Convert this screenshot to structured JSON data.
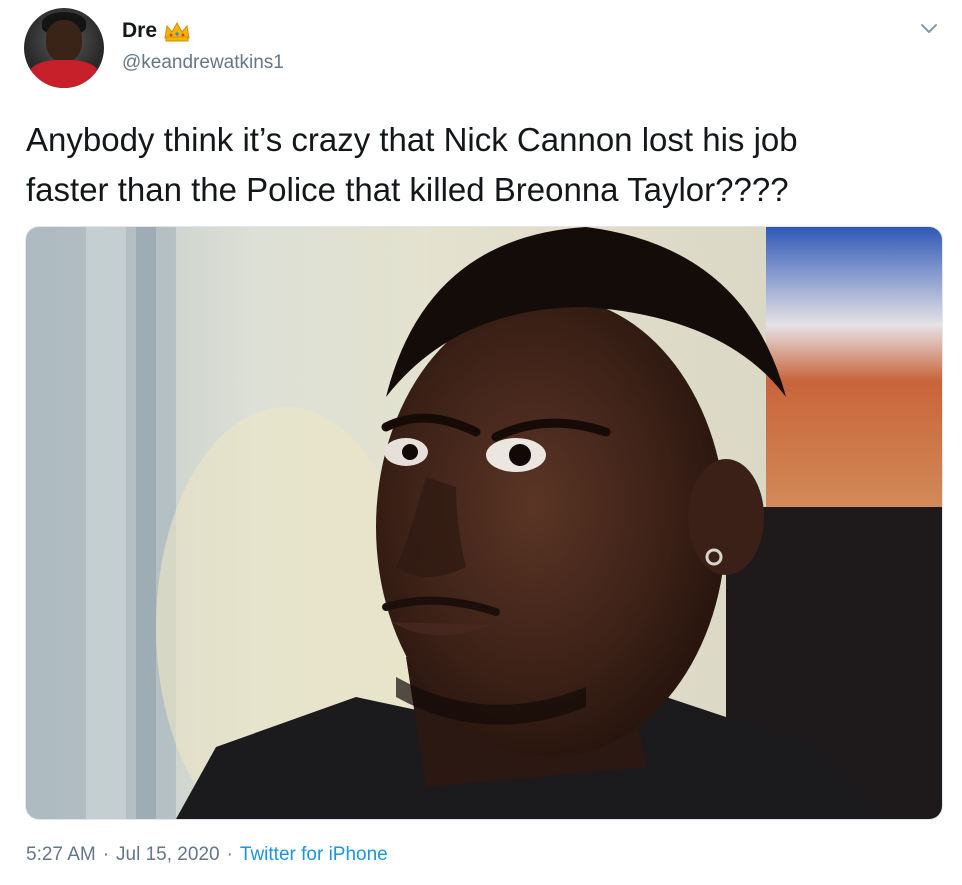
{
  "tweet": {
    "display_name": "Dre",
    "badge_icon": "crown-icon",
    "username": "@keandrewatkins1",
    "menu_icon": "chevron-down-icon",
    "text": "Anybody think it’s crazy that Nick Cannon lost his job\nfaster than the Police that killed Breonna Taylor????",
    "time": "5:27 AM",
    "separator": "·",
    "date": "Jul 15, 2020",
    "source": "Twitter for iPhone"
  },
  "colors": {
    "text": "#14171a",
    "secondary": "#657786",
    "link": "#1b95e0",
    "crown": "#f5b400"
  }
}
